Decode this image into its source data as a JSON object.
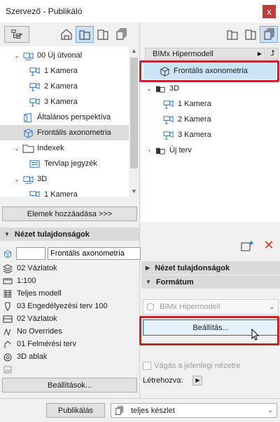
{
  "window": {
    "title": "Szervező - Publikáló",
    "close_glyph": "x"
  },
  "left": {
    "tree": [
      {
        "label": "00 Új útvonal",
        "icon": "camera-path-icon",
        "expanded": true
      },
      {
        "label": "1 Kamera",
        "icon": "camera-icon"
      },
      {
        "label": "2 Kamera",
        "icon": "camera-icon"
      },
      {
        "label": "3 Kamera",
        "icon": "camera-icon"
      },
      {
        "label": "Általános perspektíva",
        "icon": "perspective-icon"
      },
      {
        "label": "Frontális axonometria",
        "icon": "axonometry-icon",
        "selected": true
      },
      {
        "label": "Indexek",
        "icon": "folder-icon",
        "expanded": true
      },
      {
        "label": "Tervlap jegyzék",
        "icon": "index-icon"
      },
      {
        "label": "3D",
        "icon": "camera-path-icon",
        "expanded": true
      },
      {
        "label": "1 Kamera",
        "icon": "camera-icon"
      }
    ],
    "add_items_label": "Elemek hozzáadása >>>",
    "view_props_title": "Nézet tulajdonságok",
    "id_value": "",
    "name_value": "Frontális axonometria",
    "props": [
      {
        "label": "02 Vázlatok",
        "icon": "layers-icon"
      },
      {
        "label": "1:100",
        "icon": "scale-icon"
      },
      {
        "label": "Teljes modell",
        "icon": "model-icon"
      },
      {
        "label": "03 Engedélyezési terv 100",
        "icon": "pen-icon"
      },
      {
        "label": "02 Vázlatok",
        "icon": "override-icon"
      },
      {
        "label": "No Overrides",
        "icon": "graphic-override-icon"
      },
      {
        "label": "01 Felmérési terv",
        "icon": "renovation-icon"
      },
      {
        "label": "3D ablak",
        "icon": "3d-window-icon"
      }
    ],
    "settings_label": "Beállítások..."
  },
  "right": {
    "dropdown_label": "BIMx Hipermodell",
    "tree": [
      {
        "label": "Frontális axonometria",
        "icon": "axonometry-icon",
        "selected": true
      },
      {
        "label": "3D",
        "icon": "folder-3d-icon",
        "expanded": true
      },
      {
        "label": "1 Kamera",
        "icon": "camera-icon"
      },
      {
        "label": "2 Kamera",
        "icon": "camera-icon"
      },
      {
        "label": "3 Kamera",
        "icon": "camera-icon"
      },
      {
        "label": "Új terv",
        "icon": "plan-icon",
        "expanded": false
      }
    ],
    "view_props_title": "Nézet tulajdonságok",
    "format_title": "Formátum",
    "format_value": "BIMx Hipermodell",
    "settings_label": "Beállítás...",
    "crop_label": "Vágás a jelenlegi nézetre",
    "created_label": "Létrehozva:"
  },
  "footer": {
    "publish_label": "Publikálás",
    "set_value": "teljes készlet"
  },
  "colors": {
    "highlight_red": "#c0272d",
    "selected_blue": "#cce4f7"
  }
}
